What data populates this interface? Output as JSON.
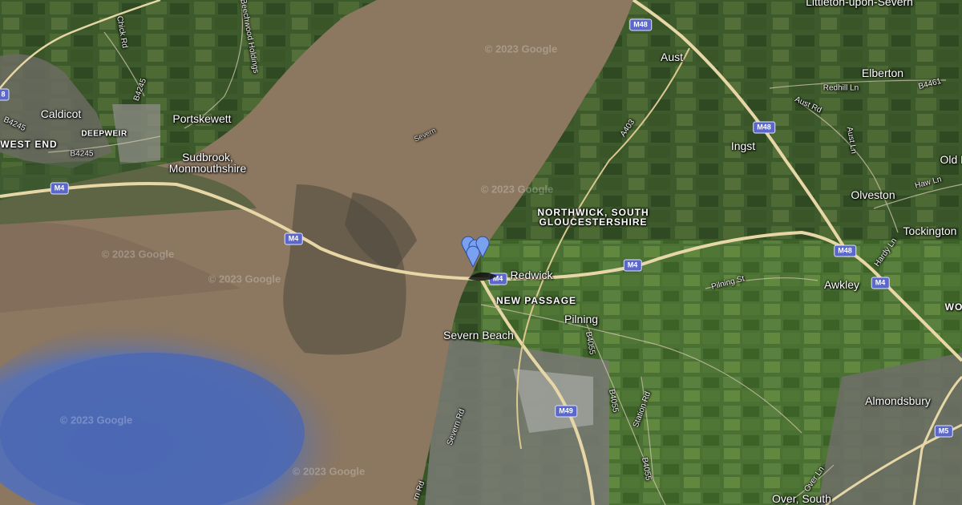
{
  "map": {
    "type": "satellite",
    "watermark": "© 2023 Google",
    "colors": {
      "estuary": "#8c7760",
      "water_deep": "#4a67b0",
      "motorway": "#e8d7a6",
      "land_dark": "#2f4a24",
      "pin": "#7aa0f0"
    }
  },
  "labels": {
    "caldicot": "Caldicot",
    "portskewett": "Portskewett",
    "deepweir": "DEEPWEIR",
    "west_end": "WEST END",
    "sudbrook_1": "Sudbrook,",
    "sudbrook_2": "Monmouthshire",
    "aust": "Aust",
    "elberton": "Elberton",
    "littleton": "Littleton-upon-Severn",
    "ingst": "Ingst",
    "olveston": "Olveston",
    "old": "Old B",
    "tockington": "Tockington",
    "northwick_1": "NORTHWICK, SOUTH",
    "northwick_2": "GLOUCESTERSHIRE",
    "redwick": "Redwick",
    "new_passage": "NEW PASSAGE",
    "pilning": "Pilning",
    "severn_beach": "Severn Beach",
    "awkley": "Awkley",
    "almondsbury": "Almondsbury",
    "over_south": "Over, South",
    "wo": "WO",
    "severn_river": "Severn"
  },
  "roads": {
    "chick_rd": "Chick Rd",
    "beechwood": "Beechwood Holdings",
    "b4245_a": "B4245",
    "b4245_b": "B4245",
    "b4245_c": "B4245",
    "a403": "A403",
    "redhill_ln": "Redhill Ln",
    "aust_rd": "Aust Rd",
    "aust_ln": "Aust Ln",
    "b4461": "B4461",
    "haw_ln": "Haw Ln",
    "hardy_ln": "Hardy Ln",
    "pilning_st": "Pilning St",
    "b4055_a": "B4055",
    "b4055_b": "B4055",
    "b4055_c": "B4055",
    "station_rd": "Station Rd",
    "severn_rd_a": "Severn Rd",
    "severn_rd_b": "rn Rd",
    "over_ln": "Over Ln"
  },
  "shields": {
    "m4_a": "M4",
    "m4_b": "M4",
    "m4_c": "M4",
    "m4_d": "M4",
    "m4_e": "M4",
    "m48_a": "M48",
    "m48_b": "M48",
    "m48_c": "M48",
    "m49": "M49",
    "m5": "M5",
    "m_left": "8"
  }
}
